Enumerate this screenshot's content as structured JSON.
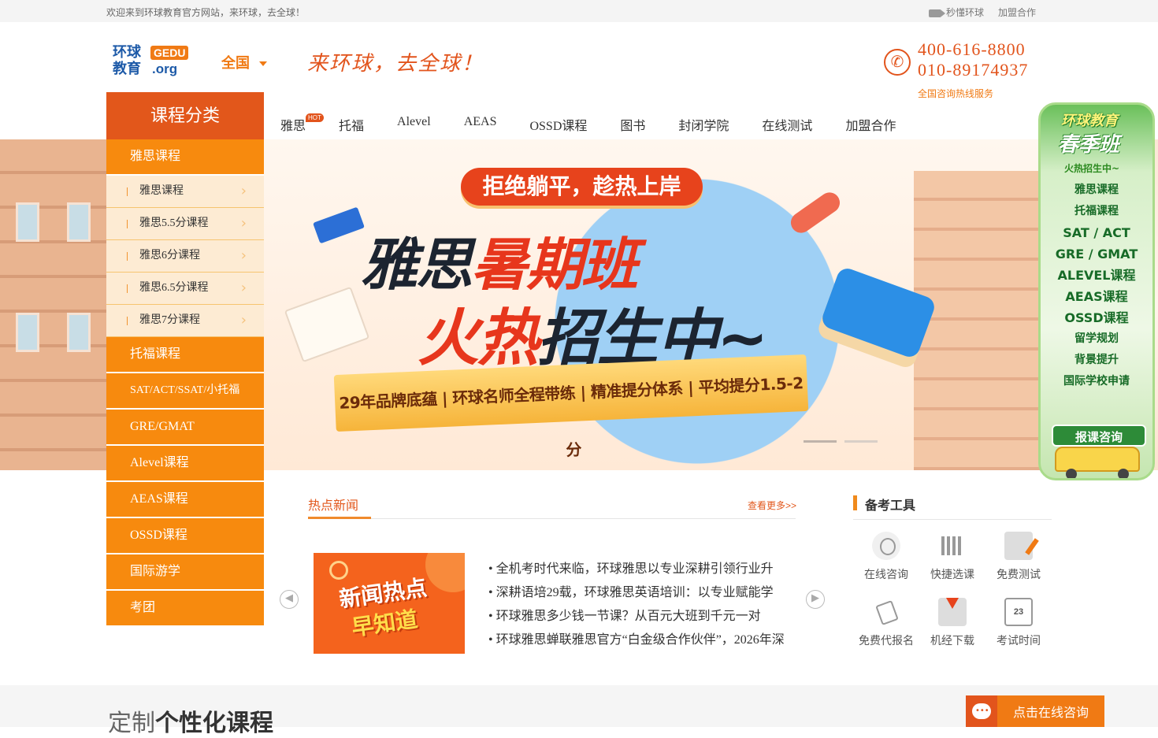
{
  "topbar": {
    "welcome": "欢迎来到环球教育官方网站，来环球，去全球！",
    "video_link": "秒懂环球",
    "join_link": "加盟合作"
  },
  "header": {
    "logo_cn": "环球教育",
    "logo_gedu": "GEDU",
    "logo_org": ".org",
    "region": "全国",
    "slogan": "来环球，去全球！",
    "phone1": "400-616-8800",
    "phone2": "010-89174937",
    "hotline_label": "全国咨询热线服务"
  },
  "nav": {
    "category_title": "课程分类",
    "hot_badge": "HOT",
    "items": [
      "雅思",
      "托福",
      "Alevel",
      "AEAS",
      "OSSD课程",
      "图书",
      "封闭学院",
      "在线测试",
      "加盟合作"
    ]
  },
  "menu": {
    "ielts": "雅思课程",
    "ielts_sub": [
      "雅思课程",
      "雅思5.5分课程",
      "雅思6分课程",
      "雅思6.5分课程",
      "雅思7分课程"
    ],
    "others": [
      "托福课程",
      "SAT/ACT/SSAT/小托福",
      "GRE/GMAT",
      "Alevel课程",
      "AEAS课程",
      "OSSD课程",
      "国际游学",
      "考团"
    ]
  },
  "banner": {
    "pill": "拒绝躺平，趁热上岸",
    "line1_a": "雅思",
    "line1_b": "暑期班",
    "line2_a": "火热",
    "line2_b": "招生中~",
    "ribbon": "29年品牌底蕴 | 环球名师全程带练 | 精准提分体系 | 平均提分1.5-2分"
  },
  "promo": {
    "title1": "环球教育",
    "title2": "春季班",
    "title3": "火热招生中~",
    "items": [
      "雅思课程",
      "托福课程",
      "SAT / ACT",
      "GRE / GMAT",
      "ALEVEL课程",
      "AEAS课程",
      "OSSD课程",
      "留学规划",
      "背景提升",
      "国际学校申请"
    ],
    "cta": "报课咨询"
  },
  "news": {
    "title": "热点新闻",
    "more": "查看更多>>",
    "img_line1": "新闻热点",
    "img_line2": "早知道",
    "items": [
      "• 全机考时代来临，环球雅思以专业深耕引领行业升",
      "• 深耕语培29载，环球雅思英语培训：以专业赋能学",
      "• 环球雅思多少钱一节课？从百元大班到千元一对",
      "• 环球雅思蝉联雅思官方“白金级合作伙伴”，2026年深"
    ]
  },
  "tools": {
    "title": "备考工具",
    "items": [
      "在线咨询",
      "快捷选课",
      "免费测试",
      "免费代报名",
      "机经下载",
      "考试时间"
    ],
    "calendar_day": "23"
  },
  "footer": {
    "custom_a": "定制",
    "custom_b": "个性化课程",
    "chat": "点击在线咨询"
  },
  "colors": {
    "brand_orange": "#f78a0e",
    "brand_red": "#e2571b",
    "logo_blue": "#1d5aa8"
  }
}
